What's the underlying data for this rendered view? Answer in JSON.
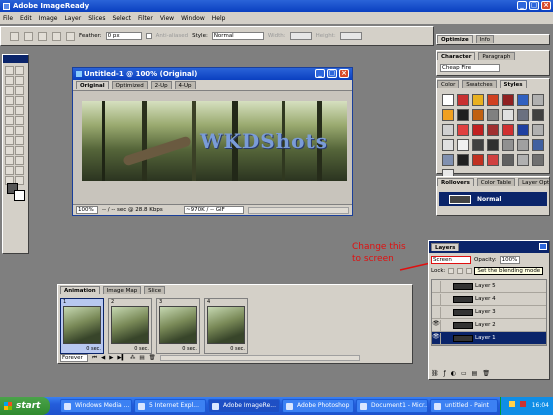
{
  "app": {
    "title": "Adobe ImageReady"
  },
  "menu": [
    "File",
    "Edit",
    "Image",
    "Layer",
    "Slices",
    "Select",
    "Filter",
    "View",
    "Window",
    "Help"
  ],
  "options": {
    "feather_label": "Feather:",
    "feather_value": "0 px",
    "antialiased": "Anti-aliased",
    "style_label": "Style:",
    "style_value": "Normal",
    "width_label": "Width:",
    "height_label": "Height:"
  },
  "doc": {
    "title": "Untitled-1 @ 100% (Original)",
    "tabs": [
      "Original",
      "Optimized",
      "2-Up",
      "4-Up"
    ],
    "watermark": "WKDShots",
    "status": {
      "zoom": "100%",
      "timing": "-- / -- sec @ 28.8 Kbps",
      "size": "~970K / -- GIF"
    }
  },
  "optimize_panel": {
    "tabs": [
      "Optimize",
      "Info"
    ]
  },
  "character_panel": {
    "tabs": [
      "Character",
      "Paragraph"
    ],
    "font": "Cheap Fire"
  },
  "styles_panel": {
    "tabs": [
      "Color",
      "Swatches",
      "Styles"
    ],
    "swatch_colors": [
      "#ffffff",
      "#c83030",
      "#e8b020",
      "#d04020",
      "#902020",
      "#3060c0",
      "#b0b0b0",
      "#f0a020",
      "#202020",
      "#c06010",
      "#808080",
      "#e0e0e0",
      "#6a7080",
      "#404040",
      "#d0d0d0",
      "#e04040",
      "#c02020",
      "#a03030",
      "#d03030",
      "#2040a0",
      "#b0b0b0",
      "#e0e0e0",
      "#f0f0f0",
      "#404040",
      "#303030",
      "#909090",
      "#a0a0a0",
      "#4060a0",
      "#8090b0",
      "#202020",
      "#c03020",
      "#d04040",
      "#606060",
      "#b0b0b0",
      "#707070",
      "#e8e8e8"
    ]
  },
  "rollovers_panel": {
    "tabs": [
      "Rollovers",
      "Color Table",
      "Layer Options"
    ],
    "state": "Normal"
  },
  "annotation": "Change this\nto screen",
  "layers_panel": {
    "title": "Layers",
    "blend_mode": "Screen",
    "opacity_label": "Opacity:",
    "opacity_value": "100%",
    "tooltip": "Set the blending mode",
    "lock_label": "Lock:",
    "layers": [
      {
        "name": "Layer 5",
        "visible": false,
        "selected": false
      },
      {
        "name": "Layer 4",
        "visible": false,
        "selected": false
      },
      {
        "name": "Layer 3",
        "visible": false,
        "selected": false
      },
      {
        "name": "Layer 2",
        "visible": true,
        "selected": false
      },
      {
        "name": "Layer 1",
        "visible": true,
        "selected": true
      }
    ]
  },
  "animation_panel": {
    "tabs": [
      "Animation",
      "Image Map",
      "Slice"
    ],
    "frames": [
      {
        "num": "1",
        "delay": "0 sec."
      },
      {
        "num": "2",
        "delay": "0 sec."
      },
      {
        "num": "3",
        "delay": "0 sec."
      },
      {
        "num": "4",
        "delay": "0 sec."
      }
    ],
    "loop": "Forever"
  },
  "taskbar": {
    "start": "start",
    "items": [
      "Windows Media ...",
      "5 Internet Expl...",
      "Adobe ImageRe...",
      "Adobe Photoshop",
      "Document1 - Micr...",
      "untitled - Paint"
    ],
    "clock": "16:04"
  }
}
